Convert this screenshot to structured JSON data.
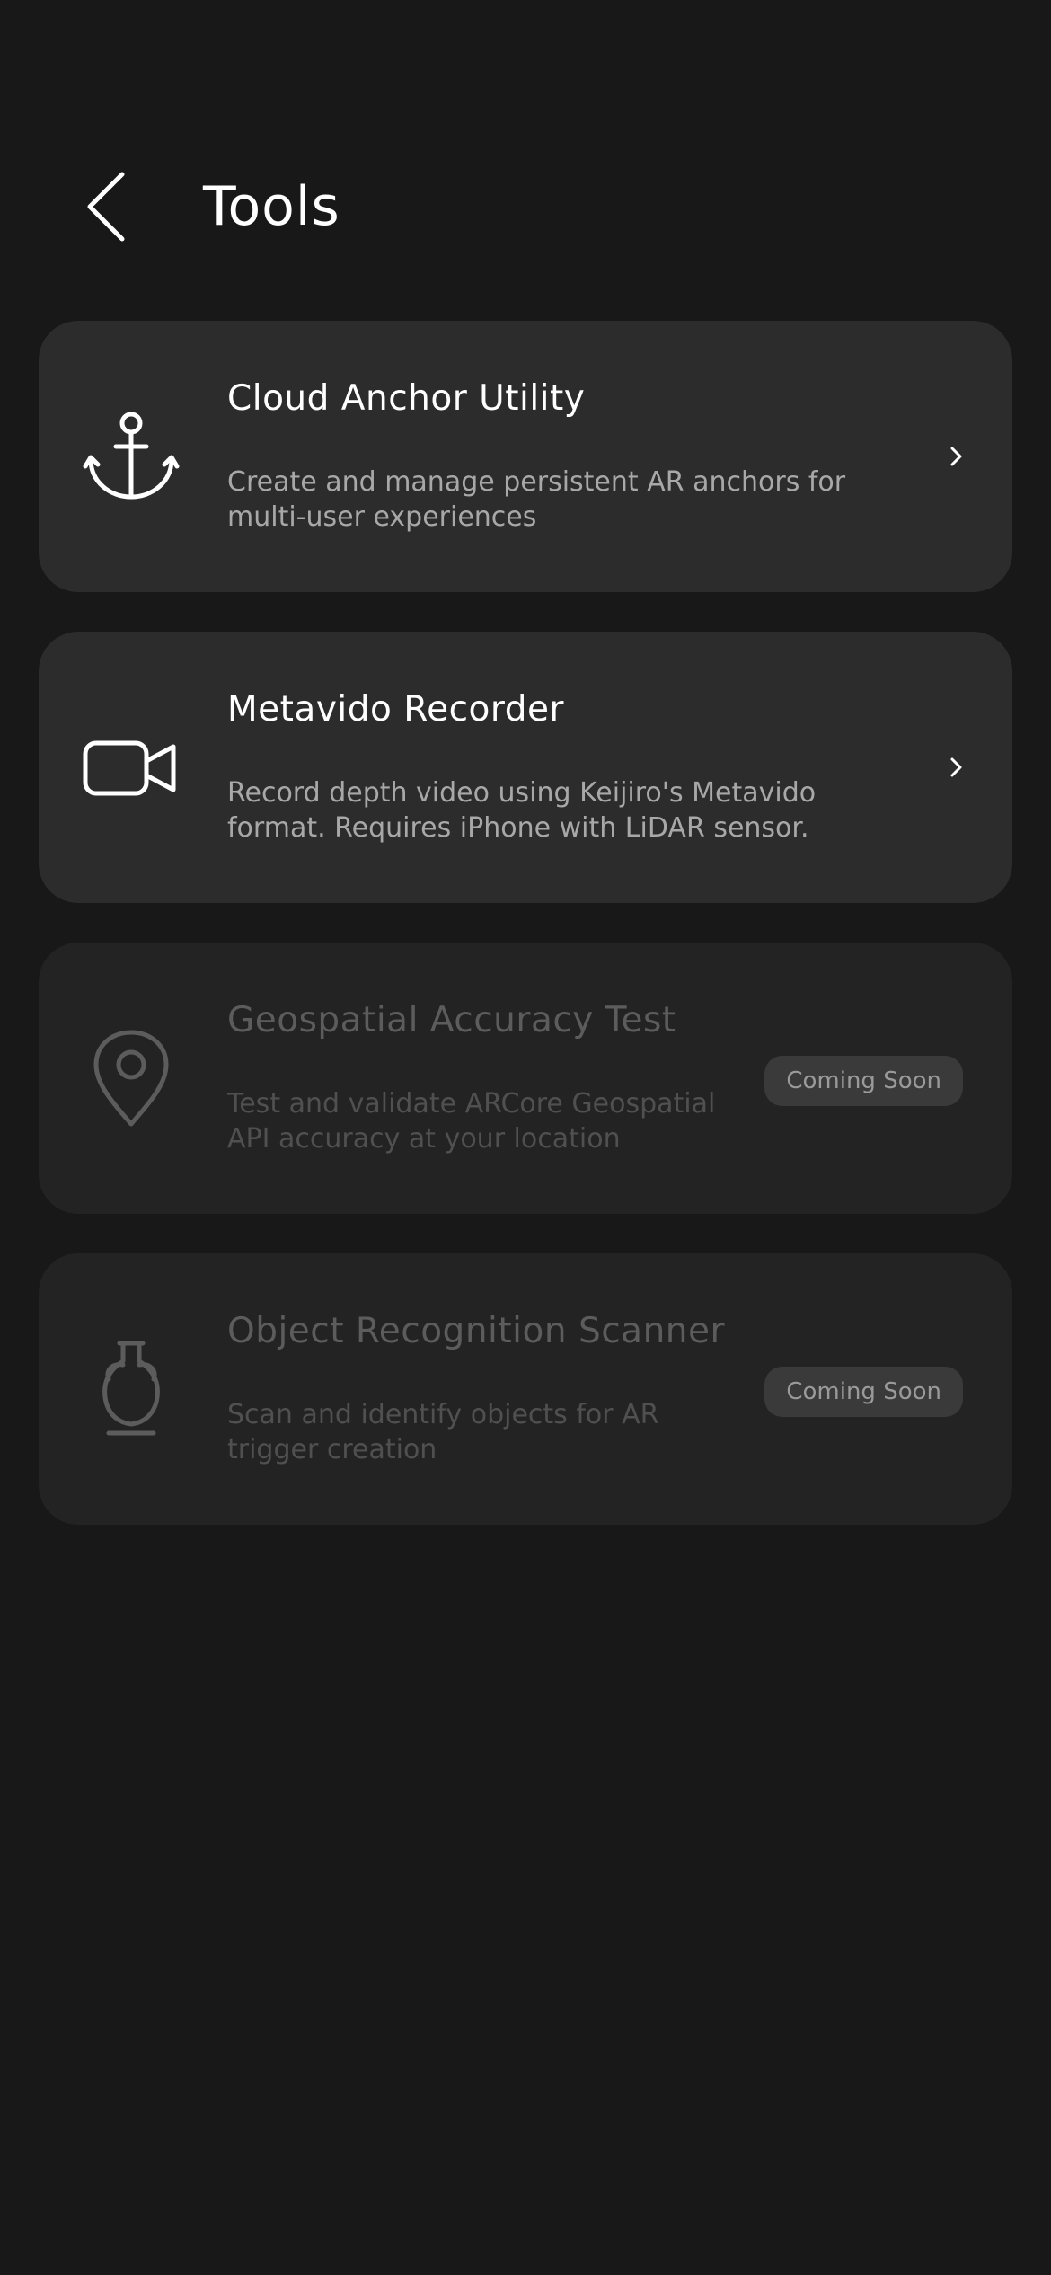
{
  "header": {
    "title": "Tools"
  },
  "tools": [
    {
      "title": "Cloud Anchor Utility",
      "description": "Create and manage persistent AR anchors for multi-user experiences",
      "icon": "anchor-icon",
      "enabled": true
    },
    {
      "title": "Metavido Recorder",
      "description": "Record depth video using Keijiro's Metavido format. Requires iPhone with LiDAR sensor.",
      "icon": "video-camera-icon",
      "enabled": true
    },
    {
      "title": "Geospatial Accuracy Test",
      "description": "Test and validate ARCore Geospatial API accuracy at your location",
      "icon": "location-pin-icon",
      "enabled": false,
      "badge": "Coming Soon"
    },
    {
      "title": "Object Recognition Scanner",
      "description": "Scan and identify objects for AR trigger creation",
      "icon": "vase-icon",
      "enabled": false,
      "badge": "Coming Soon"
    }
  ],
  "colors": {
    "background": "#181818",
    "card": "#2c2c2c",
    "card_disabled": "#232323",
    "text_primary": "#ffffff",
    "text_secondary": "#a8a8a8",
    "text_disabled": "#5c5c5c",
    "badge_bg": "#3a3a3a"
  }
}
